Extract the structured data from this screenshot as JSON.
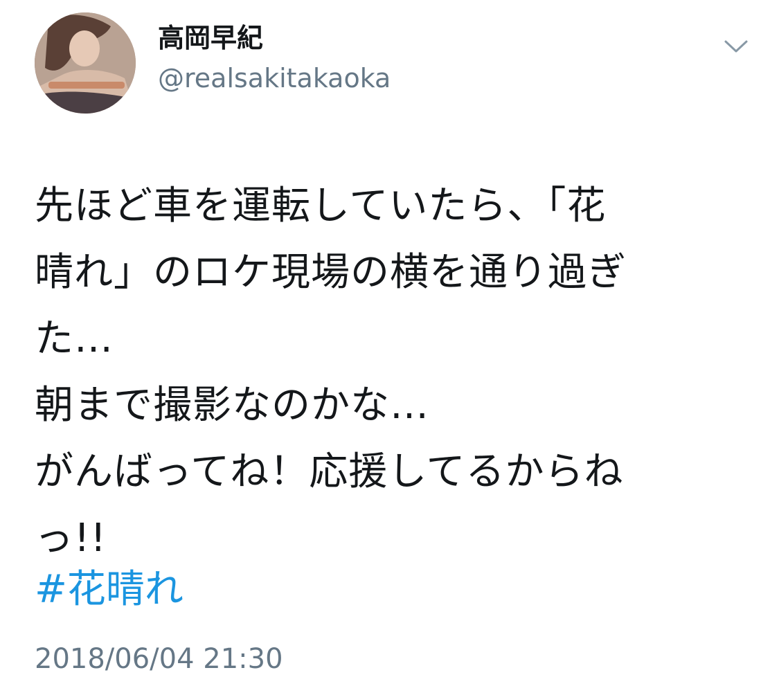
{
  "tweet": {
    "display_name": "高岡早紀",
    "handle": "@realsakitakaoka",
    "text_lines": [
      "先ほど車を運転していたら、「花",
      "晴れ」のロケ現場の横を通り過ぎ",
      "た…",
      "朝まで撮影なのかな…",
      "がんばってね！応援してるからね",
      "っ!!"
    ],
    "hashtag": "#花晴れ",
    "timestamp": "2018/06/04 21:30",
    "menu_icon": "chevron-down-icon"
  },
  "colors": {
    "text": "#14171a",
    "secondary": "#657786",
    "link": "#1b95e0",
    "background": "#ffffff"
  }
}
